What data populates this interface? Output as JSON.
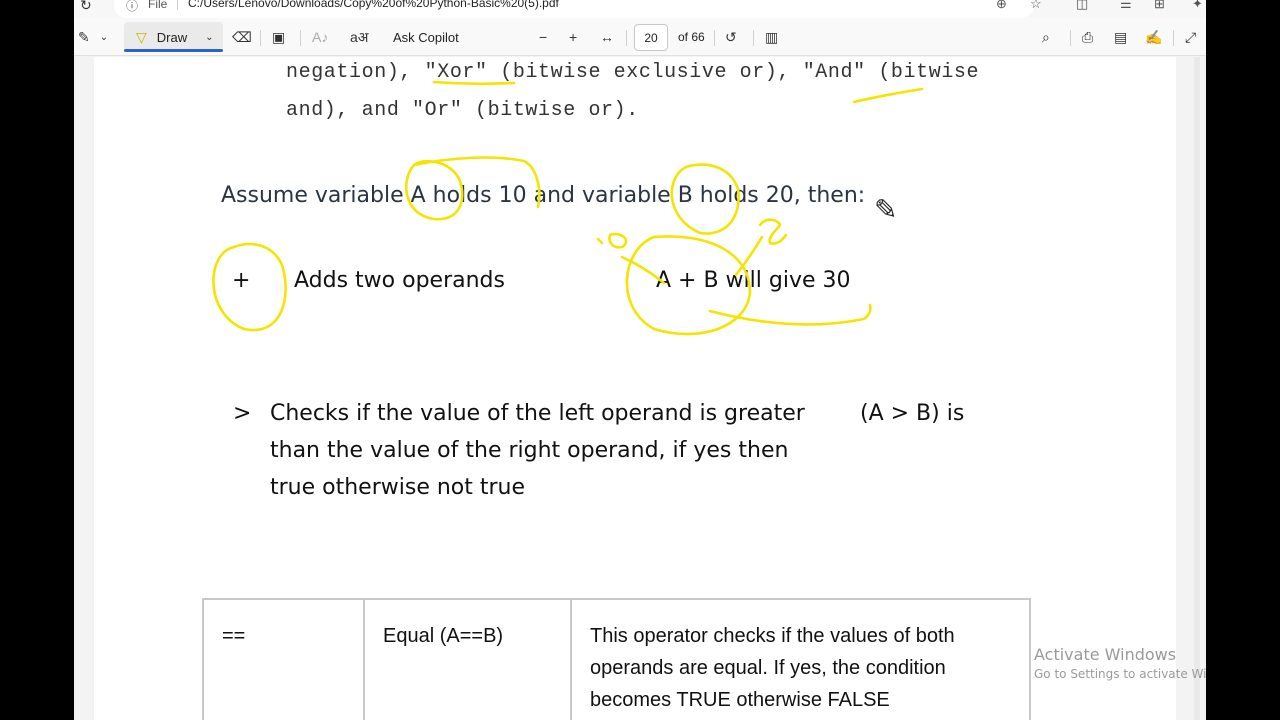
{
  "address_bar": {
    "file_label": "File",
    "url": "C:/Users/Lenovo/Downloads/Copy%20of%20Python-Basic%20(5).pdf"
  },
  "toolbar": {
    "draw_label": "Draw",
    "copilot_label": "Ask Copilot",
    "page_current": "20",
    "page_total": "of 66"
  },
  "document": {
    "line1_a": "negation), ",
    "line1_xor": "\"Xor\"",
    "line1_b": " (bitwise exclusive or), ",
    "line1_and": "\"And\"",
    "line1_c": " (bitwise",
    "line2": "and), and \"Or\" (bitwise or).",
    "assume": "Assume variable A holds 10 and variable B holds 20, then:",
    "plus_symbol": "+",
    "plus_desc": "Adds two operands",
    "plus_example": "A + B will give 30",
    "gt_symbol": ">",
    "gt_desc_1": "Checks if the value of the left operand is greater",
    "gt_desc_2": "than the value of the right operand, if yes then",
    "gt_desc_3": "true otherwise not true",
    "gt_example": "(A > B) is",
    "table": {
      "op": "==",
      "name": "Equal (A==B)",
      "desc_1": "This operator checks if the values of both",
      "desc_2": "operands are equal. If yes, the condition",
      "desc_3": "becomes TRUE otherwise FALSE"
    },
    "ink_labels": [
      "10",
      "20"
    ]
  },
  "watermark": {
    "line1": "Activate Windows",
    "line2": "Go to Settings to activate Windows."
  },
  "colors": {
    "ink": "#f5e400",
    "accent": "#2b64c8"
  }
}
